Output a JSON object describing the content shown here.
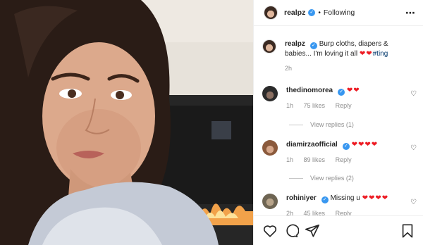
{
  "header": {
    "username": "realpz",
    "separator": "•",
    "follow_status": "Following",
    "more_icon": "more-horizontal-icon"
  },
  "caption": {
    "username": "realpz",
    "text": "Burp cloths, diapers & babies... I'm loving it all",
    "hearts": "❤❤",
    "hashtag": "#ting",
    "time": "2h"
  },
  "comments": [
    {
      "username": "thedinomorea",
      "text": "",
      "hearts": "❤❤",
      "time": "1h",
      "likes": "75 likes",
      "reply": "Reply",
      "view_replies": "View replies (1)"
    },
    {
      "username": "diamirzaofficial",
      "text": "",
      "hearts": "❤❤❤❤",
      "time": "1h",
      "likes": "89 likes",
      "reply": "Reply",
      "view_replies": "View replies (2)"
    },
    {
      "username": "rohiniyer",
      "text": "Missing u",
      "hearts": "❤❤❤❤",
      "time": "2h",
      "likes": "45 likes",
      "reply": "Reply"
    }
  ],
  "actions": {
    "like_icon": "heart-icon",
    "comment_icon": "comment-icon",
    "share_icon": "share-icon",
    "save_icon": "bookmark-icon"
  },
  "colors": {
    "verified": "#3897f0",
    "heart": "#ed1c24",
    "muted": "#8e8e8e"
  }
}
